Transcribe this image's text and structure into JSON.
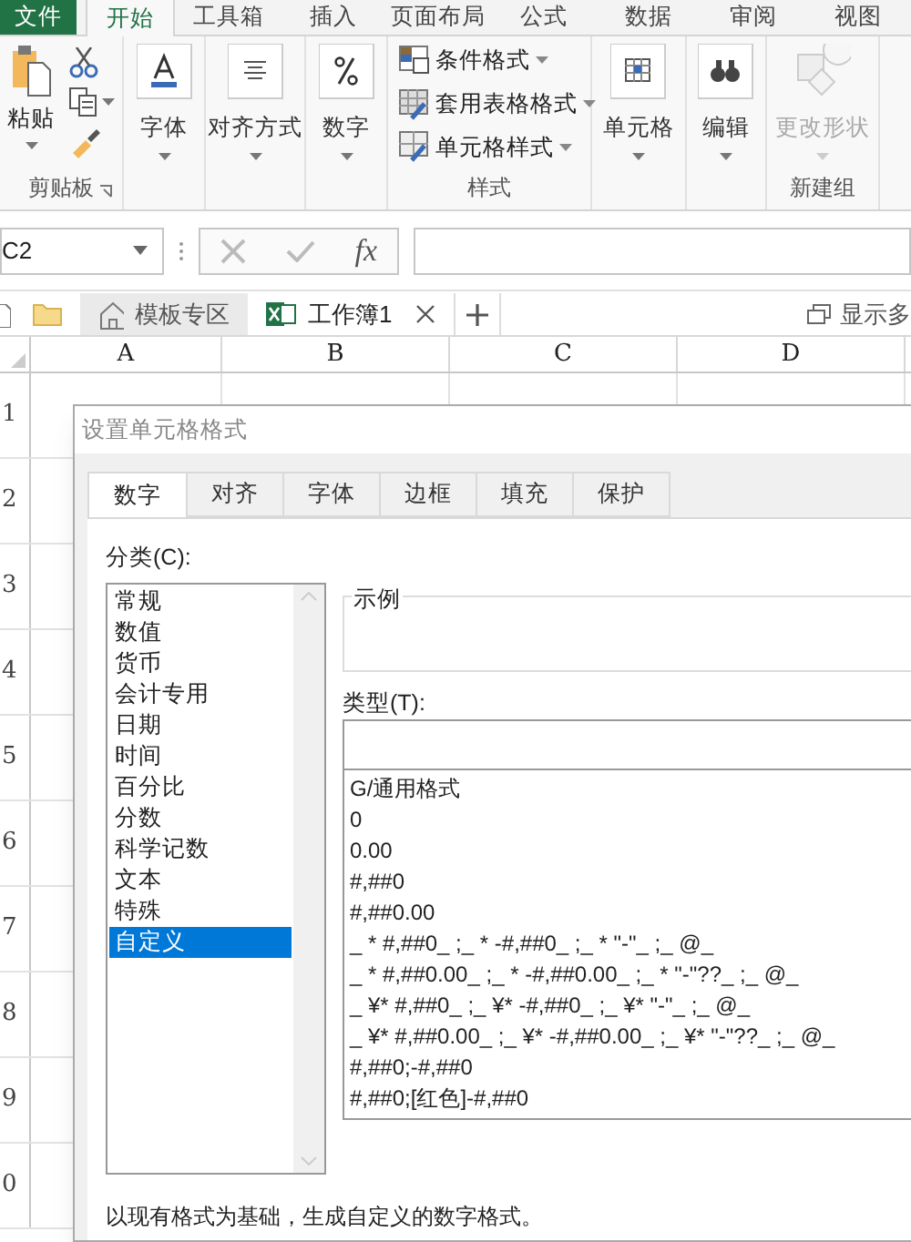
{
  "ribbon_tabs": [
    {
      "label": "文件",
      "kind": "file",
      "selected": false
    },
    {
      "label": "开始",
      "kind": "tab",
      "selected": true
    },
    {
      "label": "工具箱",
      "kind": "tab",
      "selected": false
    },
    {
      "label": "插入",
      "kind": "tab",
      "selected": false
    },
    {
      "label": "页面布局",
      "kind": "tab",
      "selected": false
    },
    {
      "label": "公式",
      "kind": "tab",
      "selected": false
    },
    {
      "label": "数据",
      "kind": "tab",
      "selected": false
    },
    {
      "label": "审阅",
      "kind": "tab",
      "selected": false
    },
    {
      "label": "视图",
      "kind": "tab",
      "selected": false
    }
  ],
  "clipboard": {
    "paste": "粘贴",
    "label": "剪贴板"
  },
  "ribbon_buttons": [
    {
      "label": "字体",
      "disabled": false
    },
    {
      "label": "对齐方式",
      "disabled": false
    },
    {
      "label": "数字",
      "disabled": false
    }
  ],
  "styles_group": {
    "items": [
      "条件格式",
      "套用表格格式",
      "单元格样式"
    ],
    "label": "样式"
  },
  "ribbon_buttons_2": [
    {
      "label": "单元格",
      "disabled": false
    },
    {
      "label": "编辑",
      "disabled": false
    }
  ],
  "new_group": {
    "button": {
      "label": "更改形状",
      "disabled": true
    },
    "label": "新建组"
  },
  "formula_bar": {
    "name_box": "C2",
    "fx": "fx"
  },
  "doc_tabs": [
    {
      "label": "模板专区",
      "selected": false,
      "closable": false
    },
    {
      "label": "工作簿1",
      "selected": true,
      "closable": true
    }
  ],
  "show_more": "显示多",
  "sheet": {
    "columns": [
      "A",
      "B",
      "C",
      "D"
    ],
    "rows": [
      "1",
      "2",
      "3",
      "4",
      "5",
      "6",
      "7",
      "8",
      "9",
      "0"
    ]
  },
  "dialog": {
    "title": "设置单元格格式",
    "tabs": [
      {
        "label": "数字",
        "selected": true
      },
      {
        "label": "对齐",
        "selected": false
      },
      {
        "label": "字体",
        "selected": false
      },
      {
        "label": "边框",
        "selected": false
      },
      {
        "label": "填充",
        "selected": false
      },
      {
        "label": "保护",
        "selected": false
      }
    ],
    "category_label": "分类(C):",
    "categories": [
      {
        "label": "常规",
        "selected": false
      },
      {
        "label": "数值",
        "selected": false
      },
      {
        "label": "货币",
        "selected": false
      },
      {
        "label": "会计专用",
        "selected": false
      },
      {
        "label": "日期",
        "selected": false
      },
      {
        "label": "时间",
        "selected": false
      },
      {
        "label": "百分比",
        "selected": false
      },
      {
        "label": "分数",
        "selected": false
      },
      {
        "label": "科学记数",
        "selected": false
      },
      {
        "label": "文本",
        "selected": false
      },
      {
        "label": "特殊",
        "selected": false
      },
      {
        "label": "自定义",
        "selected": true
      }
    ],
    "sample_label": "示例",
    "type_label": "类型(T):",
    "types": [
      "G/通用格式",
      "0",
      "0.00",
      "#,##0",
      "#,##0.00",
      "_ * #,##0_ ;_ * -#,##0_ ;_ * \"-\"_ ;_ @_",
      "_ * #,##0.00_ ;_ * -#,##0.00_ ;_ * \"-\"??_ ;_ @_",
      "_ ¥* #,##0_ ;_ ¥* -#,##0_ ;_ ¥* \"-\"_ ;_ @_",
      "_ ¥* #,##0.00_ ;_ ¥* -#,##0.00_ ;_ ¥* \"-\"??_ ;_ @_",
      "#,##0;-#,##0",
      "#,##0;[红色]-#,##0"
    ],
    "description": "以现有格式为基础，生成自定义的数字格式。"
  }
}
